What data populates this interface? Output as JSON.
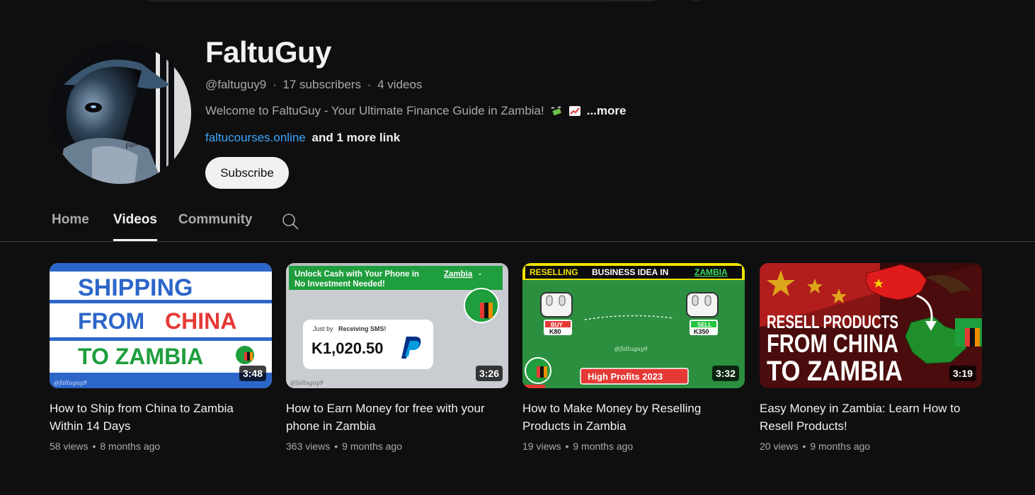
{
  "channel": {
    "name": "FaltuGuy",
    "handle": "@faltuguy9",
    "subscribers": "17 subscribers",
    "video_count": "4 videos",
    "separator": "·",
    "description": "Welcome to FaltuGuy - Your Ultimate Finance Guide in Zambia!",
    "description_emojis": [
      "money-with-wings-icon",
      "chart-increasing-icon"
    ],
    "more_label": "...more",
    "link": "faltucourses.online",
    "more_links": "and 1 more link",
    "subscribe_label": "Subscribe",
    "avatar_watermark": "FaltuGuy"
  },
  "tabs": [
    {
      "label": "Home",
      "active": false
    },
    {
      "label": "Videos",
      "active": true
    },
    {
      "label": "Community",
      "active": false
    }
  ],
  "videos": [
    {
      "title": "How to Ship from China to Zambia Within 14 Days",
      "views": "58 views",
      "age": "8 months ago",
      "duration": "3:48",
      "thumb_text": [
        "SHIPPING",
        "FROM",
        "CHINA",
        "TO ZAMBIA"
      ],
      "watermark": "@faltuguy9"
    },
    {
      "title": "How to Earn Money for free with your phone in Zambia",
      "views": "363 views",
      "age": "9 months ago",
      "duration": "3:26",
      "thumb_text": [
        "Unlock Cash with Your Phone in",
        "Zambia",
        "-",
        "No Investment Needed!",
        "Just by",
        "Receiving SMS!",
        "K1,020.50"
      ],
      "watermark": "@faltuguy9"
    },
    {
      "title": "How to Make Money by Reselling Products in Zambia",
      "views": "19 views",
      "age": "9 months ago",
      "duration": "3:32",
      "thumb_text": [
        "RESELLING",
        "BUSINESS IDEA IN",
        "ZAMBIA",
        "BUY",
        "K80",
        "SELL",
        "K350",
        "High Profits 2023"
      ],
      "watermark": "@faltuguy9"
    },
    {
      "title": "Easy Money in Zambia: Learn How to Resell Products!",
      "views": "20 views",
      "age": "9 months ago",
      "duration": "3:19",
      "thumb_text": [
        "RESELL PRODUCTS",
        "FROM CHINA",
        "TO ZAMBIA"
      ]
    }
  ],
  "colors": {
    "background": "#0f0f0f",
    "link": "#3ea6ff",
    "text_primary": "#f1f1f1",
    "text_secondary": "#aaaaaa"
  }
}
